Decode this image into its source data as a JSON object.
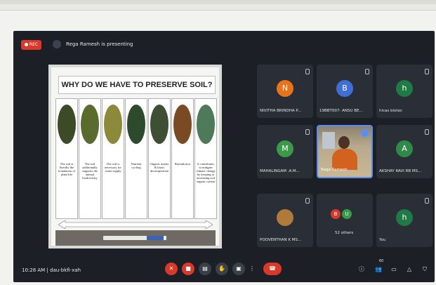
{
  "header": {
    "rec_label": "REC",
    "presenting_text": "Rega Ramesh is presenting"
  },
  "slide": {
    "title": "WHY DO WE HAVE TO PRESERVE SOIL?",
    "columns": [
      {
        "text": "The soil is literally the foundation of plant life",
        "color": "#3d4a26"
      },
      {
        "text": "The soil additionally supports the animal biodiversity",
        "color": "#5a6b2e"
      },
      {
        "text": "The soil is necessary for water supply",
        "color": "#8a8a3a"
      },
      {
        "text": "Nutrient cycling",
        "color": "#2e4a2c"
      },
      {
        "text": "Organic matter & biotic decomposition",
        "color": "#3f4f33"
      },
      {
        "text": "Bioindicator",
        "color": "#7a4a24"
      },
      {
        "text": "It contributes to mitigate climate change by keeping or increasing soil organic carbon",
        "color": "#4f7a5a"
      }
    ]
  },
  "participants": [
    {
      "name": "NIVITHA BRINDHA P...",
      "initial": "N",
      "color": "#e8731a"
    },
    {
      "name": "19BBT007- ANSU BE...",
      "initial": "B",
      "color": "#3f6fd4"
    },
    {
      "name": "hicas biotec",
      "initial": "h",
      "color": "#1f7a46"
    },
    {
      "name": "MAHALINGAM .A.M...",
      "initial": "M",
      "color": "#3b9a4a"
    },
    {
      "name": "Rega Ramesh",
      "initial": "",
      "color": ""
    },
    {
      "name": "AKSHAY RAVI RB MS...",
      "initial": "A",
      "color": "#2f8a4a"
    },
    {
      "name": "POOVENTHAN K MS...",
      "initial": "",
      "color": "#b07a3a"
    },
    {
      "name": "52 others",
      "initial": "",
      "color": ""
    },
    {
      "name": "You",
      "initial": "h",
      "color": "#1f7a46"
    }
  ],
  "others_initials": [
    "B",
    "U"
  ],
  "others_colors": [
    "#d8392a",
    "#3b9a4a"
  ],
  "footer": {
    "time": "10:28 AM",
    "separator": "|",
    "meeting_code": "dau-bkfi-xah",
    "people_count": "60"
  },
  "controls": [
    "mic-off",
    "camera-off",
    "captions",
    "raise-hand",
    "present",
    "more",
    "leave-call"
  ],
  "right_icons": [
    "info",
    "people",
    "chat",
    "activities",
    "host-controls"
  ]
}
